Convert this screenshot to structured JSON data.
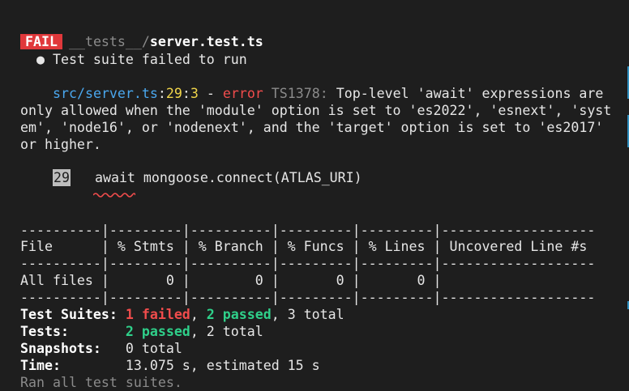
{
  "header": {
    "badge": "FAIL",
    "path_prefix": "__tests__/",
    "path_file": "server.test.ts"
  },
  "suite_msg": "● Test suite failed to run",
  "error": {
    "file": "src/server.ts",
    "sep1": ":",
    "line": "29",
    "sep2": ":",
    "col": "3",
    "dash": " - ",
    "level": "error",
    "code": "TS1378:",
    "text_line1": " Top-level 'await' expressions are",
    "text_line2": "only allowed when the 'module' option is set to 'es2022', 'esnext', 'syst",
    "text_line3": "em', 'node16', or 'nodenext', and the 'target' option is set to 'es2017'",
    "text_line4": "or higher."
  },
  "code_snippet": {
    "line_number": "29",
    "code": "await mongoose.connect(ATLAS_URI)"
  },
  "coverage_table": {
    "border_top": "----------|---------|----------|---------|---------|-------------------",
    "header": "File      | % Stmts | % Branch | % Funcs | % Lines | Uncovered Line #s ",
    "border_mid": "----------|---------|----------|---------|---------|-------------------",
    "row": "All files |       0 |        0 |       0 |       0 |                   ",
    "border_bottom": "----------|---------|----------|---------|---------|-------------------"
  },
  "summary": {
    "suites_label": "Test Suites: ",
    "suites_failed": "1 failed",
    "suites_comma": ", ",
    "suites_passed": "2 passed",
    "suites_total": ", 3 total",
    "tests_label": "Tests:       ",
    "tests_passed": "2 passed",
    "tests_total": ", 2 total",
    "snapshots_label": "Snapshots:   ",
    "snapshots_value": "0 total",
    "time_label": "Time:        ",
    "time_value": "13.075 s, estimated 15 s",
    "footer": "Ran all test suites."
  },
  "colors": {
    "background": "#1e1e1e",
    "fail": "#e0383b",
    "pass": "#2fd08a",
    "path": "#4aa7ee",
    "line_ref": "#f0d54a"
  }
}
